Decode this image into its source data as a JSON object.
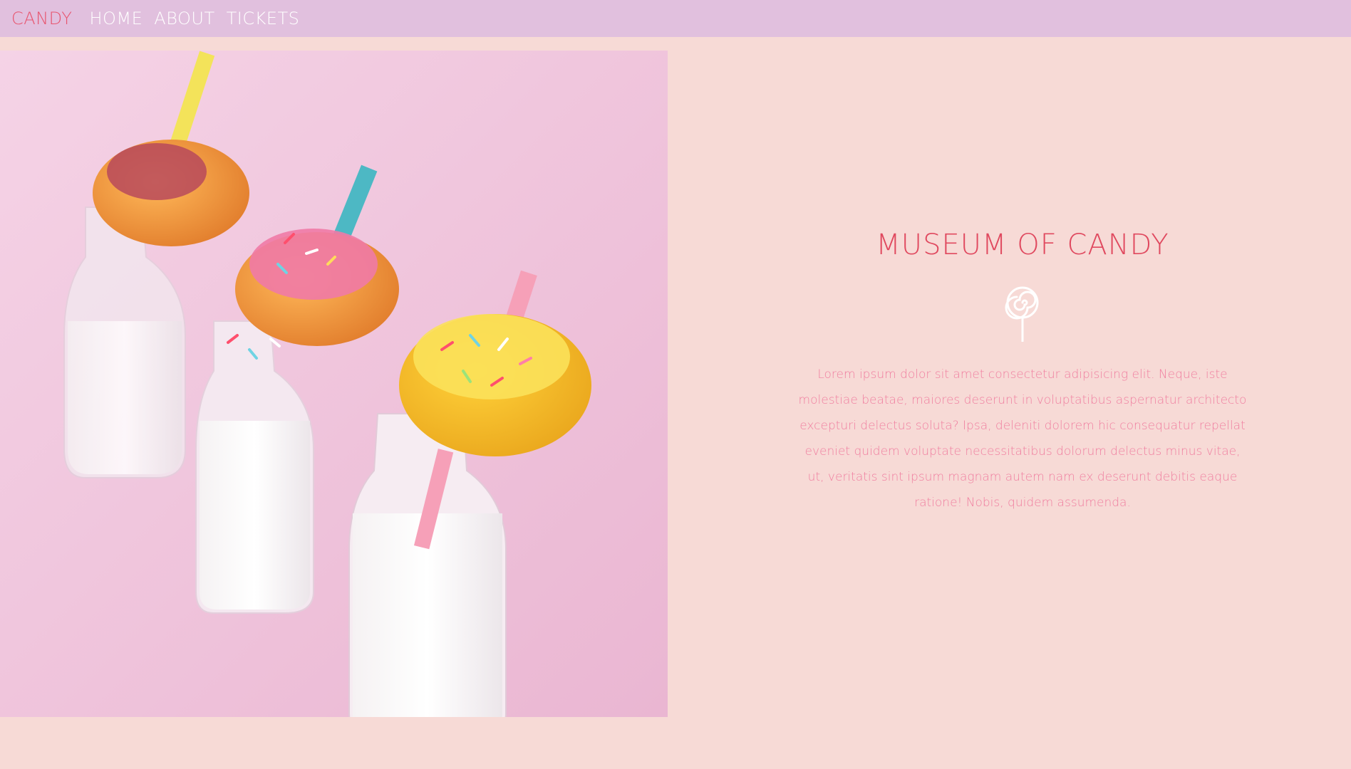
{
  "nav": {
    "brand": "CANDY",
    "links": [
      "HOME",
      "ABOUT",
      "TICKETS"
    ]
  },
  "hero": {
    "image_alt": "donuts on milk bottles with striped straws"
  },
  "content": {
    "title": "MUSEUM OF CANDY",
    "icon": "lollipop-icon",
    "body": "Lorem ipsum dolor sit amet consectetur adipisicing elit. Neque, iste molestiae beatae, maiores deserunt in voluptatibus aspernatur architecto excepturi delectus soluta? Ipsa, deleniti dolorem hic consequatur repellat eveniet quidem voluptate necessitatibus dolorum delectus minus vitae, ut, veritatis sint ipsum magnam autem nam ex deserunt debitis eaque ratione! Nobis, quidem assumenda."
  },
  "colors": {
    "navbar_bg": "#e1c0de",
    "page_bg": "#f7dad6",
    "brand": "#e8546e",
    "title": "#e0495f",
    "body_text": "#f07fa0"
  }
}
